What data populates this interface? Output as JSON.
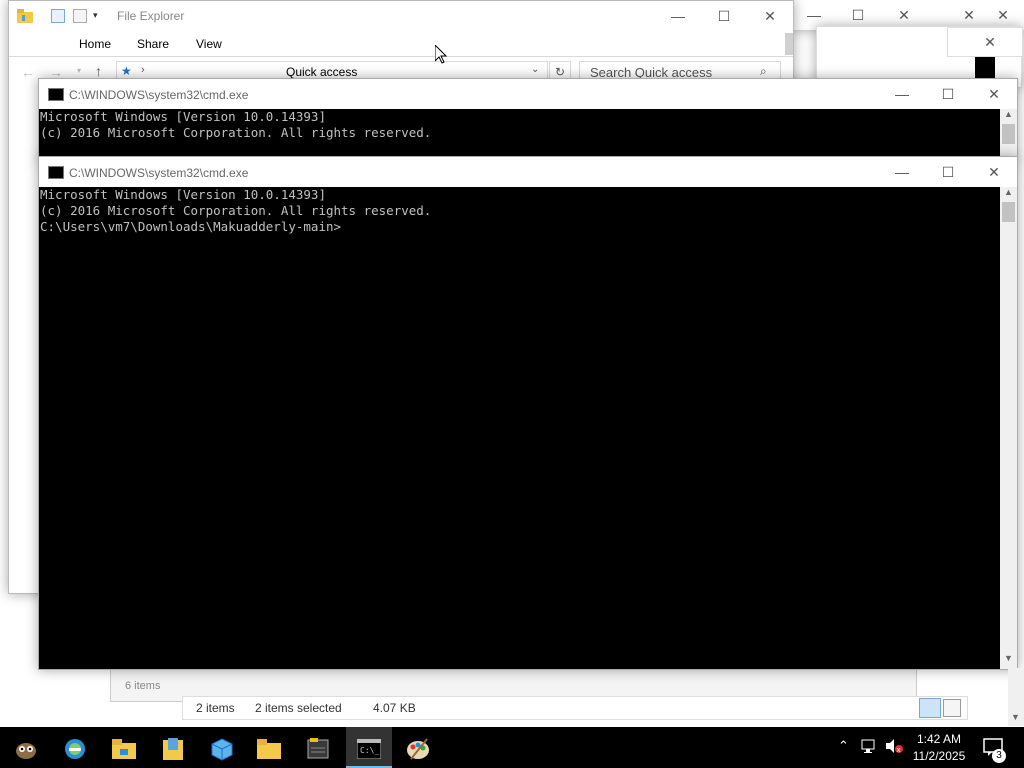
{
  "explorer": {
    "title": "File Explorer",
    "ribbon_tabs": [
      "Home",
      "Share",
      "View"
    ],
    "address": "Quick access",
    "search_placeholder": "Search Quick access",
    "status_items": "2 items",
    "status_selected": "2 items selected",
    "status_size": "4.07 KB",
    "status_items_behind": "6 items"
  },
  "cmd_back": {
    "title": "C:\\WINDOWS\\system32\\cmd.exe",
    "lines": [
      "Microsoft Windows [Version 10.0.14393]",
      "(c) 2016 Microsoft Corporation. All rights reserved."
    ]
  },
  "cmd_front": {
    "title": "C:\\WINDOWS\\system32\\cmd.exe",
    "lines": [
      "Microsoft Windows [Version 10.0.14393]",
      "(c) 2016 Microsoft Corporation. All rights reserved.",
      "",
      "C:\\Users\\vm7\\Downloads\\Makuadderly-main>"
    ]
  },
  "taskbar": {
    "time": "1:42 AM",
    "date": "11/2/2025",
    "notification_count": "3",
    "apps": [
      "start-icon",
      "ie-icon",
      "file-explorer-icon",
      "document-folder-icon",
      "box-icon",
      "folder-icon",
      "notepad-icon",
      "cmd-icon",
      "paint-icon"
    ]
  },
  "colors": {
    "taskbar": "#000000",
    "console_bg": "#000000",
    "console_fg": "#c0c0c0",
    "accent": "#1e6fd0"
  }
}
